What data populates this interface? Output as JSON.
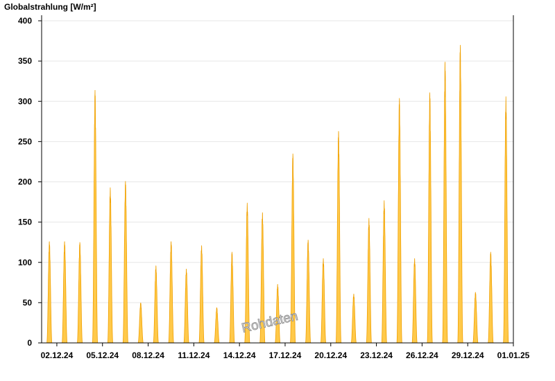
{
  "chart_data": {
    "type": "area",
    "ylabel": "Globalstrahlung [W/m²]",
    "ylim": [
      0,
      400
    ],
    "yticks": [
      "0",
      "50",
      "100",
      "150",
      "200",
      "250",
      "300",
      "350",
      "400"
    ],
    "xlim": [
      "2024-12-01",
      "2025-01-01"
    ],
    "xticks": [
      {
        "label": "02.12.24",
        "date": "2024-12-02"
      },
      {
        "label": "05.12.24",
        "date": "2024-12-05"
      },
      {
        "label": "08.12.24",
        "date": "2024-12-08"
      },
      {
        "label": "11.12.24",
        "date": "2024-12-11"
      },
      {
        "label": "14.12.24",
        "date": "2024-12-14"
      },
      {
        "label": "17.12.24",
        "date": "2024-12-17"
      },
      {
        "label": "20.12.24",
        "date": "2024-12-20"
      },
      {
        "label": "23.12.24",
        "date": "2024-12-23"
      },
      {
        "label": "26.12.24",
        "date": "2024-12-26"
      },
      {
        "label": "29.12.24",
        "date": "2024-12-29"
      },
      {
        "label": "01.01.25",
        "date": "2025-01-01"
      }
    ],
    "grid": "horizontal",
    "fill_color": "#ffc94a",
    "line_color": "#f0a000",
    "series": [
      {
        "daily_peaks": [
          {
            "date": "2024-12-01",
            "peak": 126
          },
          {
            "date": "2024-12-02",
            "peak": 126
          },
          {
            "date": "2024-12-03",
            "peak": 125
          },
          {
            "date": "2024-12-04",
            "peak": 314
          },
          {
            "date": "2024-12-05",
            "peak": 193
          },
          {
            "date": "2024-12-06",
            "peak": 201
          },
          {
            "date": "2024-12-07",
            "peak": 50
          },
          {
            "date": "2024-12-08",
            "peak": 96
          },
          {
            "date": "2024-12-09",
            "peak": 126
          },
          {
            "date": "2024-12-10",
            "peak": 92
          },
          {
            "date": "2024-12-11",
            "peak": 121
          },
          {
            "date": "2024-12-12",
            "peak": 44
          },
          {
            "date": "2024-12-13",
            "peak": 113
          },
          {
            "date": "2024-12-14",
            "peak": 174
          },
          {
            "date": "2024-12-15",
            "peak": 162
          },
          {
            "date": "2024-12-16",
            "peak": 73
          },
          {
            "date": "2024-12-17",
            "peak": 235
          },
          {
            "date": "2024-12-18",
            "peak": 128
          },
          {
            "date": "2024-12-19",
            "peak": 105
          },
          {
            "date": "2024-12-20",
            "peak": 263
          },
          {
            "date": "2024-12-21",
            "peak": 61
          },
          {
            "date": "2024-12-22",
            "peak": 155
          },
          {
            "date": "2024-12-23",
            "peak": 177
          },
          {
            "date": "2024-12-24",
            "peak": 304
          },
          {
            "date": "2024-12-25",
            "peak": 105
          },
          {
            "date": "2024-12-26",
            "peak": 311
          },
          {
            "date": "2024-12-27",
            "peak": 349
          },
          {
            "date": "2024-12-28",
            "peak": 370
          },
          {
            "date": "2024-12-29",
            "peak": 63
          },
          {
            "date": "2024-12-30",
            "peak": 113
          },
          {
            "date": "2024-12-31",
            "peak": 306
          }
        ]
      }
    ],
    "watermark": "Rohdaten"
  }
}
